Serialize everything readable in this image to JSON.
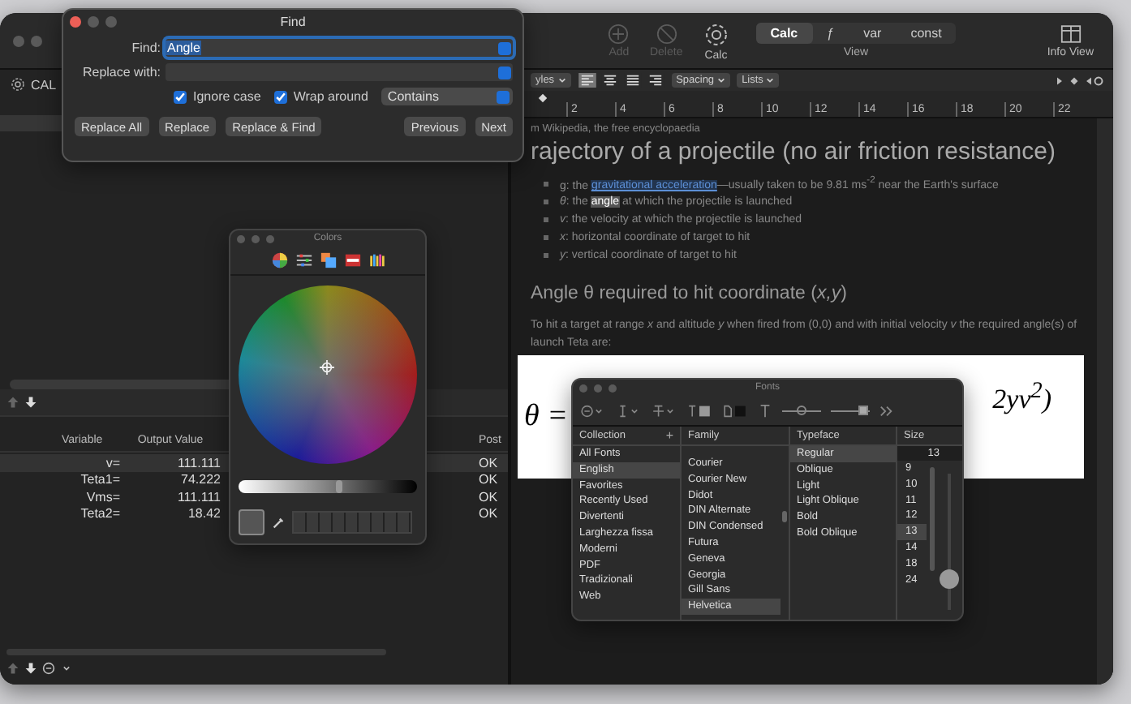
{
  "main_window": {
    "toolbar": {
      "buttons": [
        {
          "label": "Add",
          "disabled": true
        },
        {
          "label": "Delete",
          "disabled": true
        },
        {
          "label": "Calc",
          "disabled": false
        }
      ],
      "view": {
        "label": "View",
        "segments": [
          {
            "label": "Calc",
            "selected": true
          },
          {
            "label": "ƒ",
            "selected": false
          },
          {
            "label": "var",
            "selected": false
          },
          {
            "label": "const",
            "selected": false
          }
        ]
      },
      "info_view": "Info View"
    },
    "sidebar": {
      "title": "CAL",
      "table": {
        "columns": [
          "Variable",
          "Output Value",
          "Post"
        ],
        "rows": [
          {
            "variable": "v=",
            "value": "111.111",
            "post": "OK",
            "selected": true
          },
          {
            "variable": "Teta1=",
            "value": "74.222",
            "post": "OK",
            "selected": false
          },
          {
            "variable": "Vms=",
            "value": "111.111",
            "post": "OK",
            "selected": false
          },
          {
            "variable": "Teta2=",
            "value": "18.42",
            "post": "OK",
            "selected": false
          }
        ]
      }
    },
    "format_bar": {
      "styles": "yles",
      "alignment": [
        {
          "selected": true
        },
        {
          "selected": false
        },
        {
          "selected": false
        },
        {
          "selected": false
        }
      ],
      "spacing": "Spacing",
      "lists": "Lists"
    },
    "ruler": [
      "2",
      "4",
      "6",
      "8",
      "10",
      "12",
      "14",
      "16",
      "18",
      "20",
      "22"
    ],
    "document": {
      "source": "m Wikipedia, the free encyclopaedia",
      "title": "rajectory of a projectile (no air friction resistance)",
      "bullets": [
        [
          {
            "kind": "plain",
            "text": "g: the "
          },
          {
            "kind": "link",
            "text": "gravitational acceleration"
          },
          {
            "kind": "plain",
            "text": "—usually taken to be 9.81 ms$^{-2}$ near the Earth's surface"
          }
        ],
        [
          {
            "kind": "plain",
            "text": "*θ*: the "
          },
          {
            "kind": "match",
            "text": "angle"
          },
          {
            "kind": "plain",
            "text": " at which the projectile is launched"
          }
        ],
        [
          {
            "kind": "plain",
            "text": "*v*: the velocity at which the projectile is launched"
          }
        ],
        [
          {
            "kind": "plain",
            "text": "*x*: horizontal coordinate of target to hit"
          }
        ],
        [
          {
            "kind": "plain",
            "text": "*y*: vertical coordinate of target to hit"
          }
        ]
      ],
      "heading": "Angle θ required to hit coordinate (*x,y*)",
      "paragraph": "To hit a target at range *x* and altitude *y* when fired from (0,0) and with initial velocity *v* the required angle(s) of launch Teta are:",
      "formula_left": "θ =",
      "formula_right": "2yv$^{2}$)"
    }
  },
  "find": {
    "title": "Find",
    "find_label": "Find:",
    "find_value": "Angle",
    "replace_label": "Replace with:",
    "options": [
      {
        "label": "Ignore case",
        "checked": true
      },
      {
        "label": "Wrap around",
        "checked": true
      }
    ],
    "mode": "Contains",
    "buttons": [
      "Replace All",
      "Replace",
      "Replace & Find",
      "Previous",
      "Next"
    ]
  },
  "colors": {
    "title": "Colors",
    "brightness": {
      "level": 0.56
    }
  },
  "fonts": {
    "title": "Fonts",
    "shadow_sliders": [
      {
        "level": 0.5
      },
      {
        "level": 0.85
      }
    ],
    "columns": [
      "Collection",
      "Family",
      "Typeface",
      "Size"
    ],
    "collection_add": "+",
    "collections": [
      {
        "label": "All Fonts",
        "selected": false
      },
      {
        "label": "English",
        "selected": true
      },
      {
        "label": "Favorites",
        "selected": false
      },
      {
        "label": "Recently Used",
        "selected": false
      },
      {
        "label": "Divertenti",
        "selected": false
      },
      {
        "label": "Larghezza fissa",
        "selected": false
      },
      {
        "label": "Moderni",
        "selected": false
      },
      {
        "label": "PDF",
        "selected": false
      },
      {
        "label": "Tradizionali",
        "selected": false
      },
      {
        "label": "Web",
        "selected": false
      }
    ],
    "families": [
      {
        "label": "Courier",
        "selected": false
      },
      {
        "label": "Courier New",
        "selected": false
      },
      {
        "label": "Didot",
        "selected": false
      },
      {
        "label": "DIN Alternate",
        "selected": false
      },
      {
        "label": "DIN Condensed",
        "selected": false
      },
      {
        "label": "Futura",
        "selected": false
      },
      {
        "label": "Geneva",
        "selected": false
      },
      {
        "label": "Georgia",
        "selected": false
      },
      {
        "label": "Gill Sans",
        "selected": false
      },
      {
        "label": "Helvetica",
        "selected": true
      }
    ],
    "typefaces": [
      {
        "label": "Regular",
        "selected": true
      },
      {
        "label": "Oblique",
        "selected": false
      },
      {
        "label": "Light",
        "selected": false
      },
      {
        "label": "Light Oblique",
        "selected": false
      },
      {
        "label": "Bold",
        "selected": false
      },
      {
        "label": "Bold Oblique",
        "selected": false
      }
    ],
    "size_value": "13",
    "sizes": [
      {
        "label": "9",
        "selected": false
      },
      {
        "label": "10",
        "selected": false
      },
      {
        "label": "11",
        "selected": false
      },
      {
        "label": "12",
        "selected": false
      },
      {
        "label": "13",
        "selected": true
      },
      {
        "label": "14",
        "selected": false
      },
      {
        "label": "18",
        "selected": false
      },
      {
        "label": "24",
        "selected": false
      }
    ],
    "size_slider": {
      "level": 0.15
    }
  }
}
